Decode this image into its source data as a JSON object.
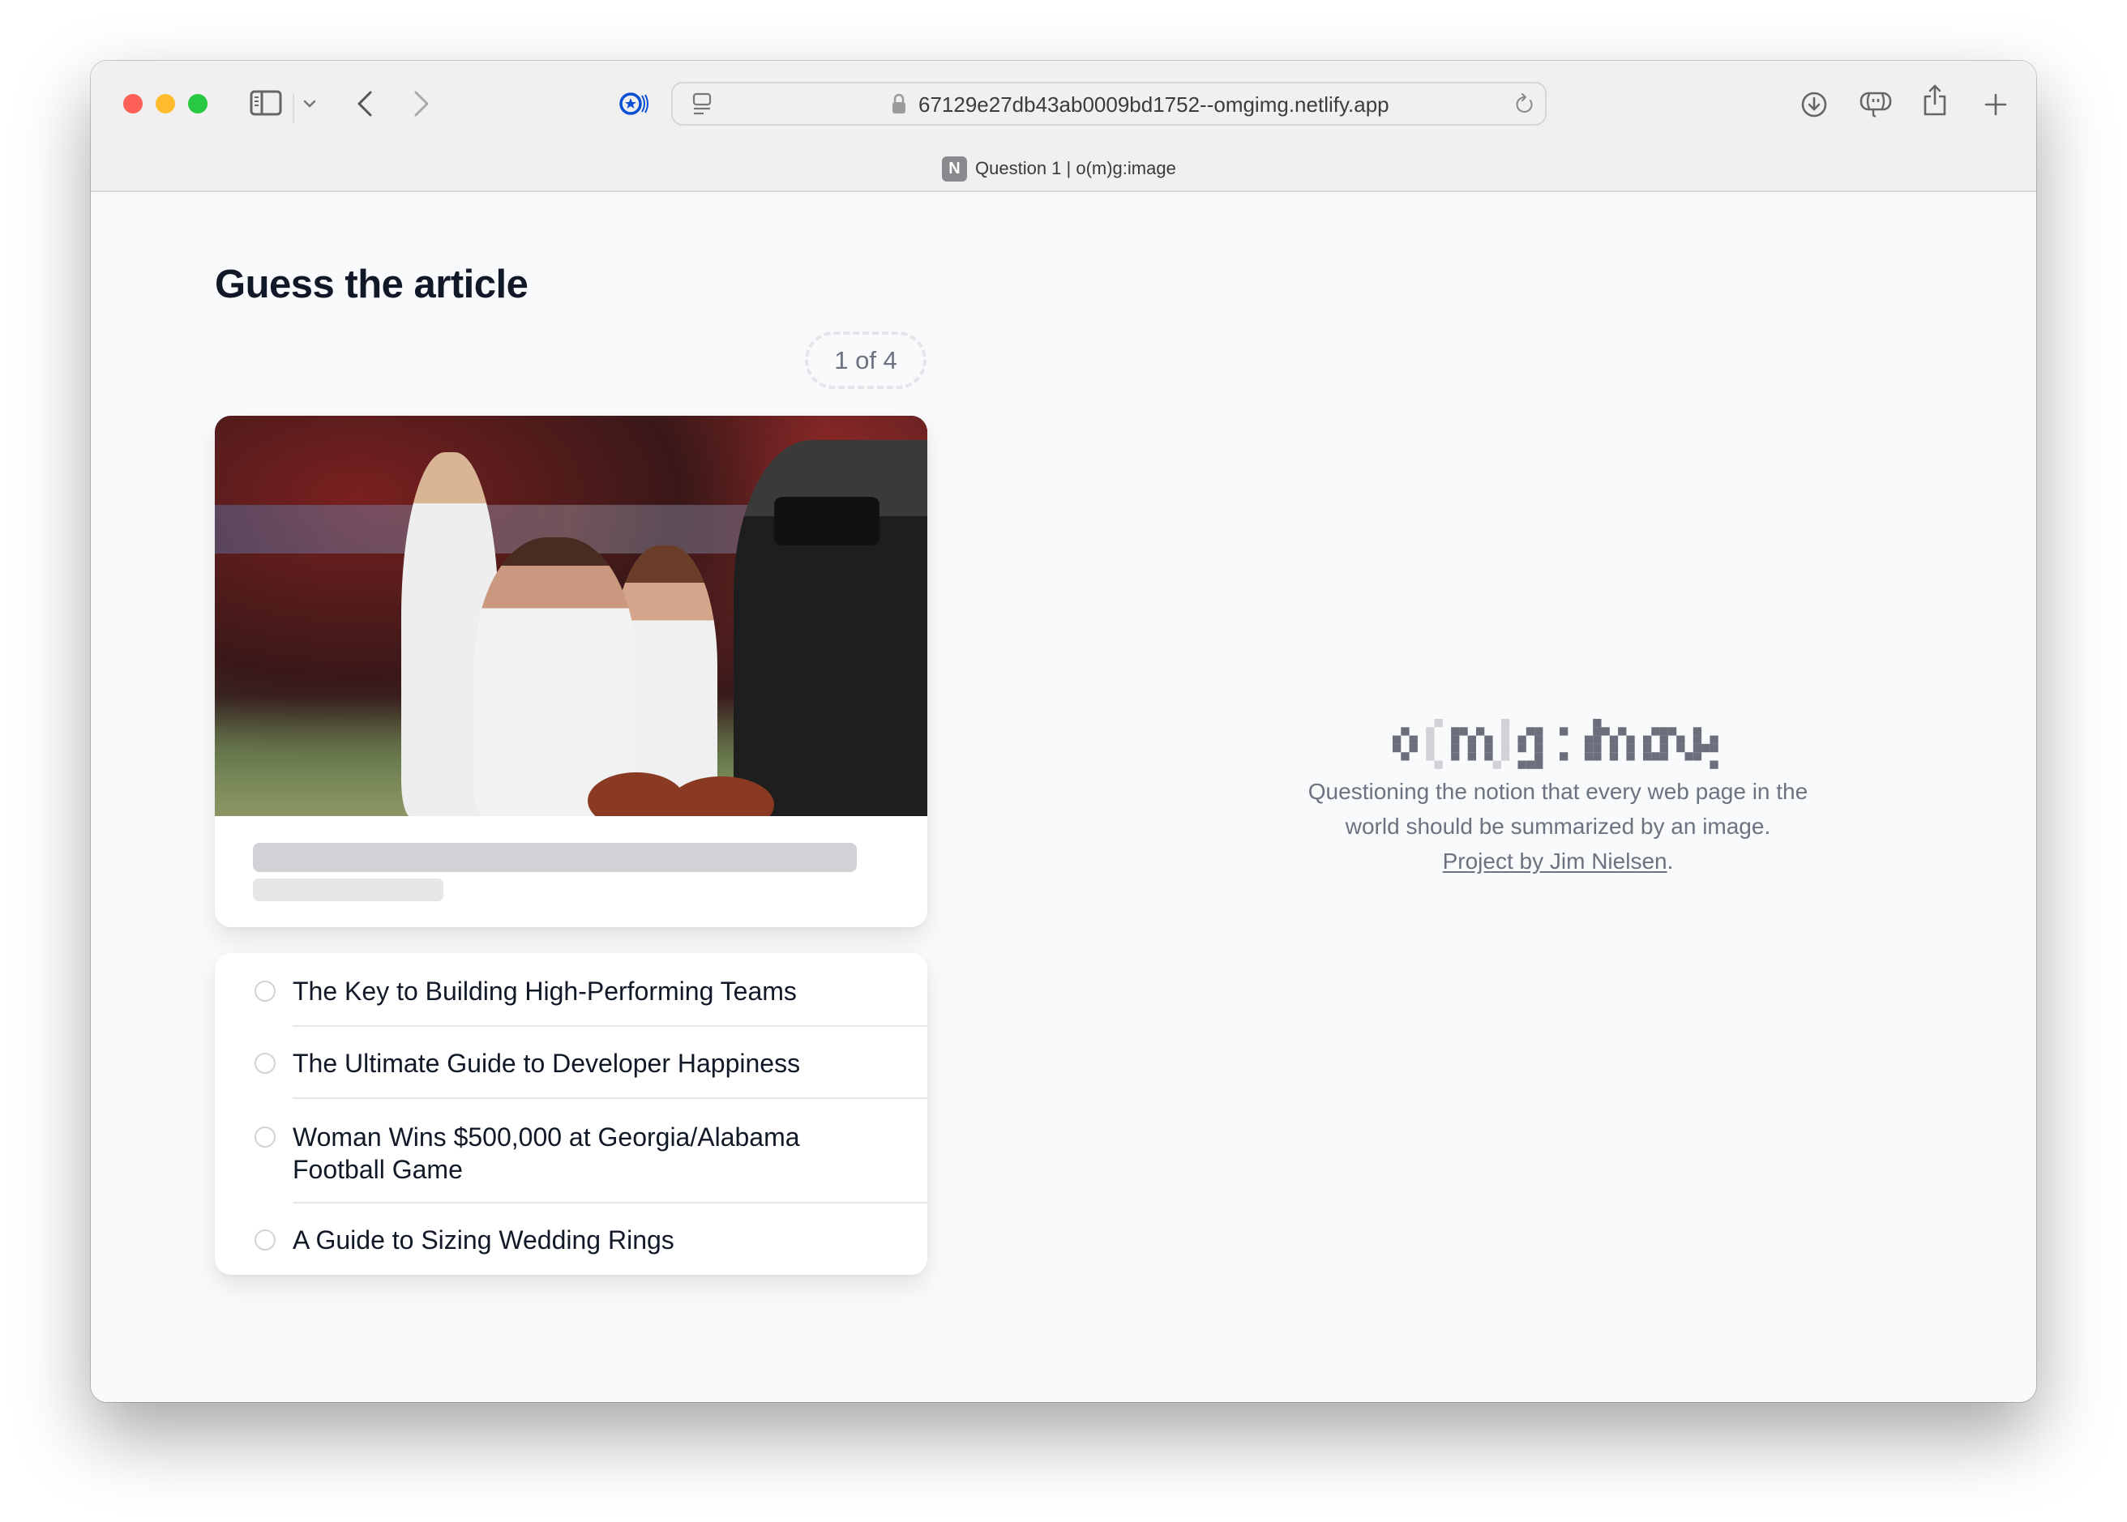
{
  "browser": {
    "url": "67129e27db43ab0009bd1752--omgimg.netlify.app",
    "tab": {
      "favicon_letter": "N",
      "title": "Question 1 | o(m)g:image"
    },
    "toolbar_icons": [
      "sidebar-icon",
      "chevron-down-icon",
      "back-icon",
      "forward-icon",
      "privacy-tracker-icon",
      "reader-icon",
      "lock-icon",
      "reload-icon",
      "download-icon",
      "translate-icon",
      "share-icon",
      "new-tab-icon"
    ]
  },
  "quiz": {
    "title": "Guess the article",
    "progress": {
      "current": 1,
      "total": 4,
      "label": "1 of 4"
    },
    "card": {
      "image_alt": "Woman in a Georgia jersey reacting emotionally on a football field while a cameraman films her",
      "title_placeholder": "",
      "subtitle_placeholder": ""
    },
    "options": [
      {
        "label": "The Key to Building High-Performing Teams",
        "selected": false
      },
      {
        "label": "The Ultimate Guide to Developer Happiness",
        "selected": false
      },
      {
        "label": "Woman Wins $500,000 at Georgia/Alabama Football Game",
        "selected": false
      },
      {
        "label": "A Guide to Sizing Wedding Rings",
        "selected": false
      }
    ]
  },
  "brand": {
    "logo_text": "o(m)g:image",
    "tagline": "Questioning the notion that every web page in the world should be summarized by an image.",
    "credit_link": "Project by Jim Nielsen",
    "credit_suffix": "."
  },
  "colors": {
    "heading": "#111827",
    "muted_text": "#6b7280",
    "logo_dark": "#6b6f7b",
    "logo_light": "#d1d2d6",
    "skeleton_primary": "#d1d2d6",
    "skeleton_secondary": "#e6e6e6",
    "page_background": "#f9fafb",
    "tracker_blue": "#0a4fd6"
  }
}
